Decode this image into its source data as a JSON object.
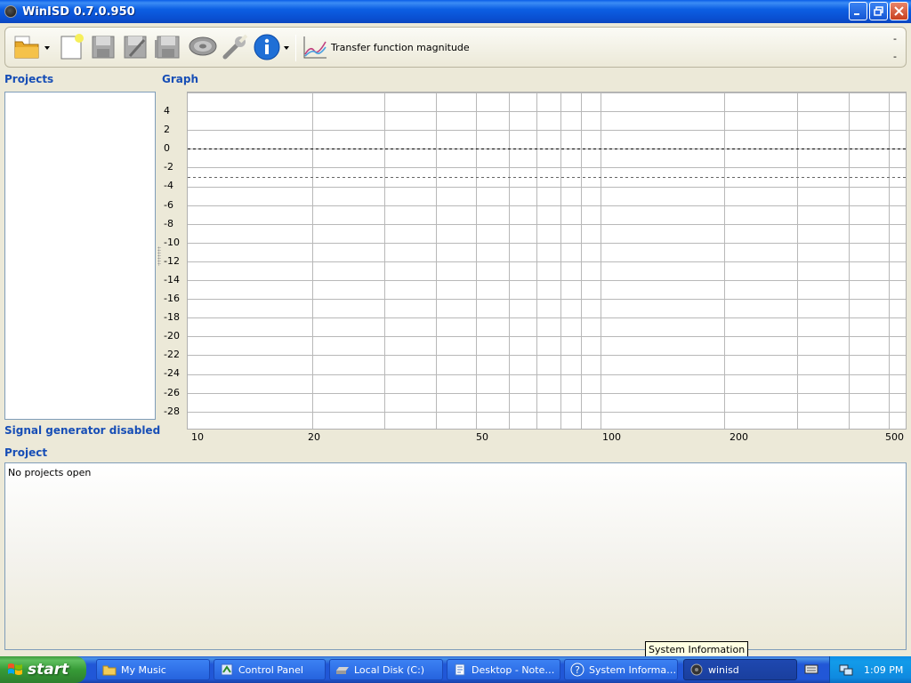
{
  "window": {
    "title": "WinISD 0.7.0.950"
  },
  "toolbar": {
    "graph_mode_label": "Transfer function magnitude",
    "right_top": "-",
    "right_bottom": "-",
    "buttons": [
      "open-icon",
      "new-project-icon",
      "save-icon",
      "save-as-icon",
      "save-all-icon",
      "driver-editor-icon",
      "options-icon",
      "info-icon",
      "graph-icon"
    ]
  },
  "projects": {
    "heading": "Projects"
  },
  "signal_generator": {
    "status": "Signal generator disabled"
  },
  "graph": {
    "heading": "Graph",
    "y_ticks": [
      "4",
      "2",
      "0",
      "-2",
      "-4",
      "-6",
      "-8",
      "-10",
      "-12",
      "-14",
      "-16",
      "-18",
      "-20",
      "-22",
      "-24",
      "-26",
      "-28"
    ],
    "x_ticks": [
      "10",
      "20",
      "50",
      "100",
      "200",
      "500"
    ]
  },
  "project": {
    "heading": "Project",
    "status": "No projects open"
  },
  "tooltip": {
    "text": "System Information"
  },
  "taskbar": {
    "start_label": "start",
    "items": [
      {
        "label": "My Music",
        "icon": "folder-icon"
      },
      {
        "label": "Control Panel",
        "icon": "control-panel-icon"
      },
      {
        "label": "Local Disk (C:)",
        "icon": "drive-icon"
      },
      {
        "label": "Desktop - Note…",
        "icon": "notepad-icon"
      },
      {
        "label": "System Informa…",
        "icon": "help-icon"
      },
      {
        "label": "winisd",
        "icon": "speaker-icon"
      }
    ],
    "clock": "1:09 PM"
  },
  "colors": {
    "heading": "#174eb6",
    "titlebar": "#0a4fd1",
    "taskbar": "#2157d7",
    "start": "#379b37"
  }
}
